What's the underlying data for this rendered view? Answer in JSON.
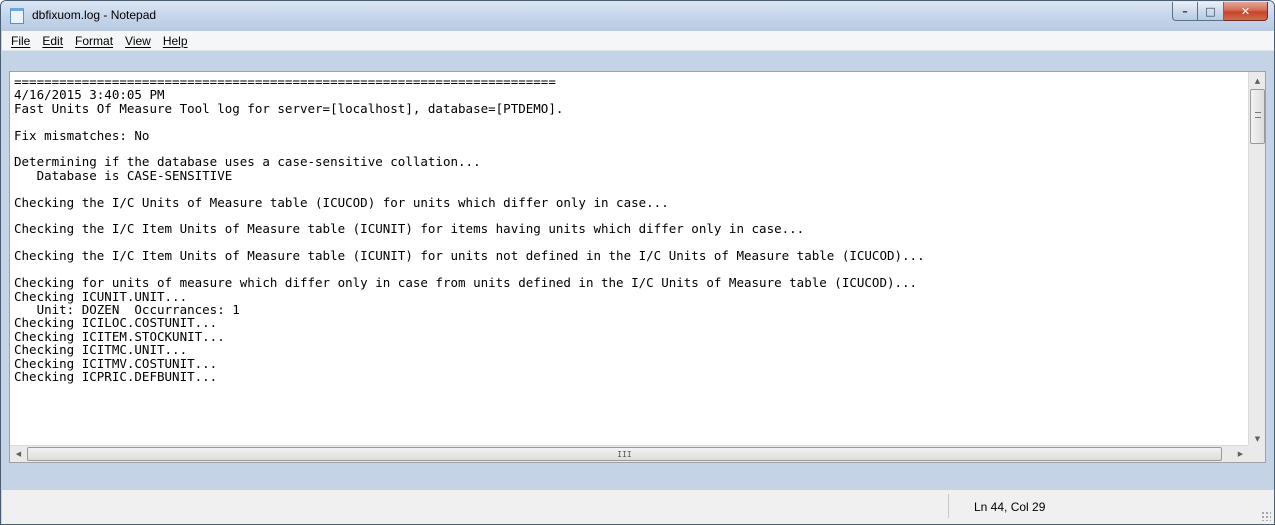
{
  "window": {
    "title": "dbfixuom.log - Notepad",
    "icon": "notepad-icon"
  },
  "caption_buttons": {
    "minimize": "minimize-icon",
    "maximize": "maximize-icon",
    "close": "close-icon"
  },
  "menu": {
    "items": [
      "File",
      "Edit",
      "Format",
      "View",
      "Help"
    ]
  },
  "document": {
    "lines": [
      "========================================================================",
      "4/16/2015 3:40:05 PM",
      "Fast Units Of Measure Tool log for server=[localhost], database=[PTDEMO].",
      "",
      "Fix mismatches: No",
      "",
      "Determining if the database uses a case-sensitive collation...",
      "   Database is CASE-SENSITIVE",
      "",
      "Checking the I/C Units of Measure table (ICUCOD) for units which differ only in case...",
      "",
      "Checking the I/C Item Units of Measure table (ICUNIT) for items having units which differ only in case...",
      "",
      "Checking the I/C Item Units of Measure table (ICUNIT) for units not defined in the I/C Units of Measure table (ICUCOD)...",
      "",
      "Checking for units of measure which differ only in case from units defined in the I/C Units of Measure table (ICUCOD)...",
      "Checking ICUNIT.UNIT...",
      "   Unit: DOZEN  Occurrances: 1",
      "Checking ICILOC.COSTUNIT...",
      "Checking ICITEM.STOCKUNIT...",
      "Checking ICITMC.UNIT...",
      "Checking ICITMV.COSTUNIT...",
      "Checking ICPRIC.DEFBUNIT..."
    ]
  },
  "scrollbars": {
    "h_thumb_grip": "III"
  },
  "status": {
    "position": "Ln 44, Col 29"
  }
}
